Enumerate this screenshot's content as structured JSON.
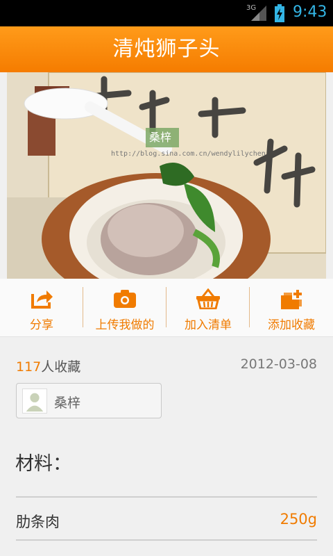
{
  "status_bar": {
    "network": "3G",
    "time": "9:43"
  },
  "header": {
    "title": "清炖狮子头"
  },
  "photo": {
    "watermark_name": "桑梓",
    "watermark_url": "http://blog.sina.com.cn/wendylilychen"
  },
  "actions": [
    {
      "label": "分享",
      "icon": "share-icon"
    },
    {
      "label": "上传我做的",
      "icon": "camera-icon"
    },
    {
      "label": "加入清单",
      "icon": "basket-icon"
    },
    {
      "label": "添加收藏",
      "icon": "add-favorite-icon"
    }
  ],
  "info": {
    "favorites_count": "117",
    "favorites_suffix": "人收藏",
    "date": "2012-03-08",
    "author": "桑梓"
  },
  "ingredients": {
    "title": "材料：",
    "items": [
      {
        "name": "肋条肉",
        "amount": "250g"
      }
    ]
  },
  "colors": {
    "accent": "#f07b00",
    "header_top": "#ff9b1a",
    "header_bottom": "#f57c00",
    "status_text": "#33b5e5"
  }
}
